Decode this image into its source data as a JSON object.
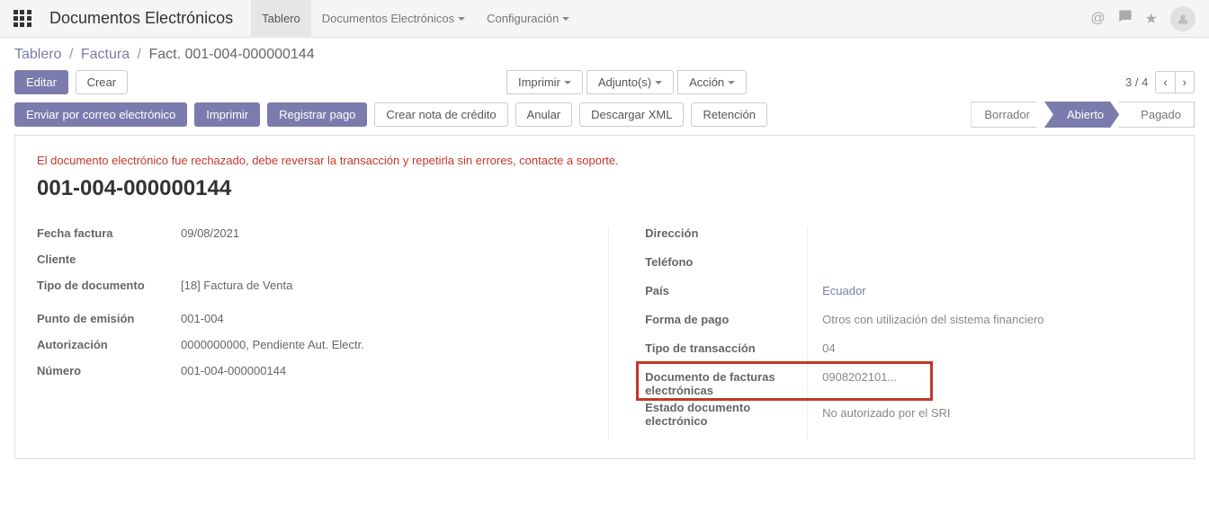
{
  "navbar": {
    "brand": "Documentos Electrónicos",
    "tabs": [
      {
        "label": "Tablero",
        "active": true
      },
      {
        "label": "Documentos Electrónicos",
        "dropdown": true
      },
      {
        "label": "Configuración",
        "dropdown": true
      }
    ]
  },
  "breadcrumb": {
    "items": [
      "Tablero",
      "Factura"
    ],
    "current": "Fact. 001-004-000000144"
  },
  "buttons": {
    "edit": "Editar",
    "create": "Crear",
    "print": "Imprimir",
    "attachments": "Adjunto(s)",
    "action": "Acción"
  },
  "pager": {
    "text": "3 / 4"
  },
  "action_buttons": {
    "send_email": "Enviar por correo electrónico",
    "print2": "Imprimir",
    "register_payment": "Registrar pago",
    "credit_note": "Crear nota de crédito",
    "cancel": "Anular",
    "download_xml": "Descargar XML",
    "retention": "Retención"
  },
  "status": {
    "draft": "Borrador",
    "open": "Abierto",
    "paid": "Pagado",
    "active": "open"
  },
  "alert": "El documento electrónico fue rechazado, debe reversar la transacción y repetirla sin errores, contacte a soporte.",
  "doc_number": "001-004-000000144",
  "left_fields": {
    "fecha_factura": {
      "label": "Fecha factura",
      "value": "09/08/2021"
    },
    "cliente": {
      "label": "Cliente",
      "value": ""
    },
    "tipo_documento": {
      "label": "Tipo de documento",
      "value": "[18] Factura de Venta"
    },
    "punto_emision": {
      "label": "Punto de emisión",
      "value": "001-004"
    },
    "autorizacion": {
      "label": "Autorización",
      "value": "0000000000, Pendiente Aut. Electr."
    },
    "numero": {
      "label": "Número",
      "value": "001-004-000000144"
    }
  },
  "right_fields": {
    "direccion": {
      "label": "Dirección",
      "value": ""
    },
    "telefono": {
      "label": "Teléfono",
      "value": ""
    },
    "pais": {
      "label": "País",
      "value": "Ecuador"
    },
    "forma_pago": {
      "label": "Forma de pago",
      "value": "Otros con utilización del sistema financiero"
    },
    "tipo_transaccion": {
      "label": "Tipo de transacción",
      "value": "04"
    },
    "doc_facturas": {
      "label": "Documento de facturas electrónicas",
      "value": "0908202101..."
    },
    "estado_doc": {
      "label": "Estado documento electrónico",
      "value": "No autorizado por el SRI"
    }
  }
}
